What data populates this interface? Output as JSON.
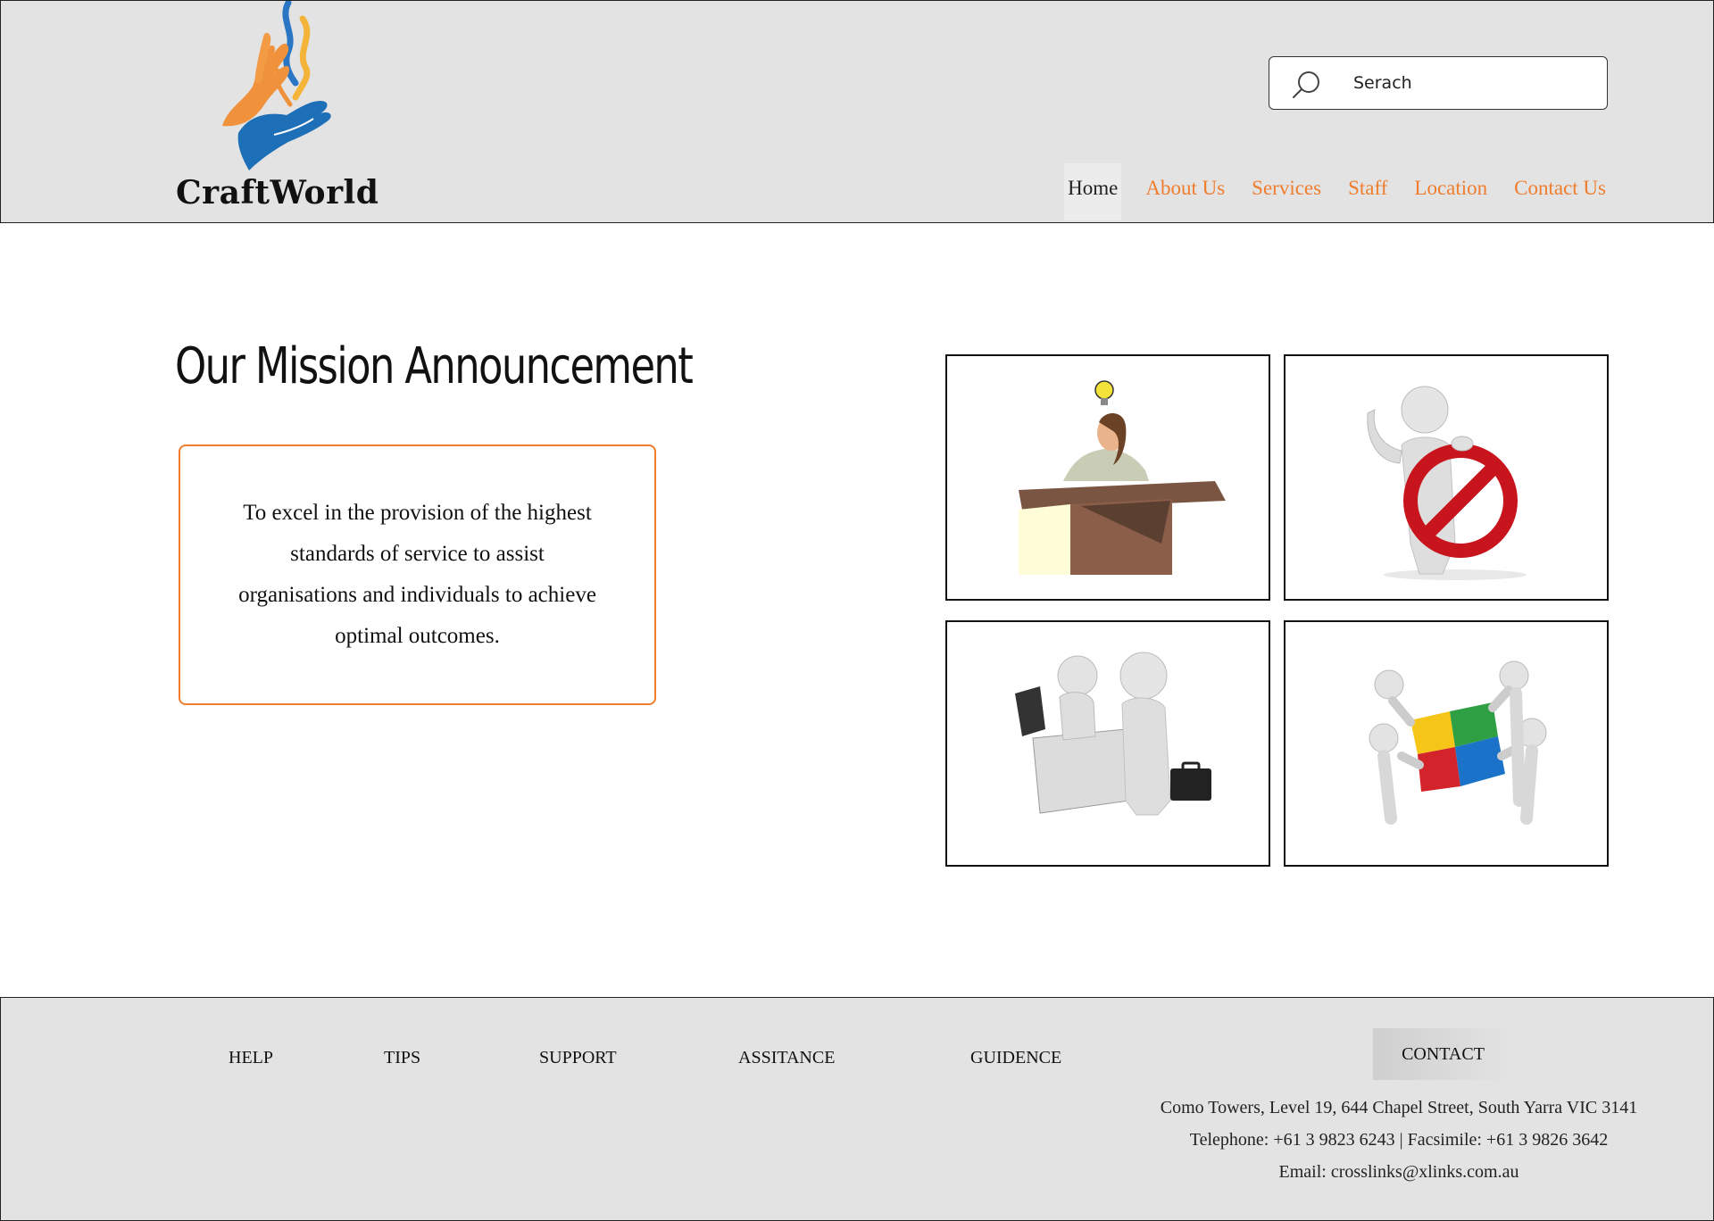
{
  "brand": {
    "name": "CraftWorld",
    "accent": "#ef7d2d"
  },
  "search": {
    "placeholder": "Serach"
  },
  "nav": {
    "items": [
      {
        "label": "Home",
        "active": true
      },
      {
        "label": "About Us"
      },
      {
        "label": "Services"
      },
      {
        "label": "Staff"
      },
      {
        "label": "Location"
      },
      {
        "label": "Contact Us"
      }
    ]
  },
  "main": {
    "title": "Our Mission Announcement",
    "mission_text": "To excel in the provision of the highest standards of service to assist organisations and individuals to achieve optimal outcomes.",
    "images": [
      {
        "icon": "idea-person-in-box-image"
      },
      {
        "icon": "stop-sign-figure-image"
      },
      {
        "icon": "business-handshake-image"
      },
      {
        "icon": "puzzle-teamwork-image"
      }
    ]
  },
  "footer": {
    "links": [
      "HELP",
      "TIPS",
      "SUPPORT",
      "ASSITANCE",
      "GUIDENCE"
    ],
    "contact_label": "CONTACT",
    "address": "Como Towers, Level 19, 644 Chapel Street, South Yarra VIC 3141",
    "phone": "Telephone: +61 3 9823 6243 | Facsimile: +61 3 9826 3642",
    "email": "Email: crosslinks@xlinks.com.au"
  }
}
